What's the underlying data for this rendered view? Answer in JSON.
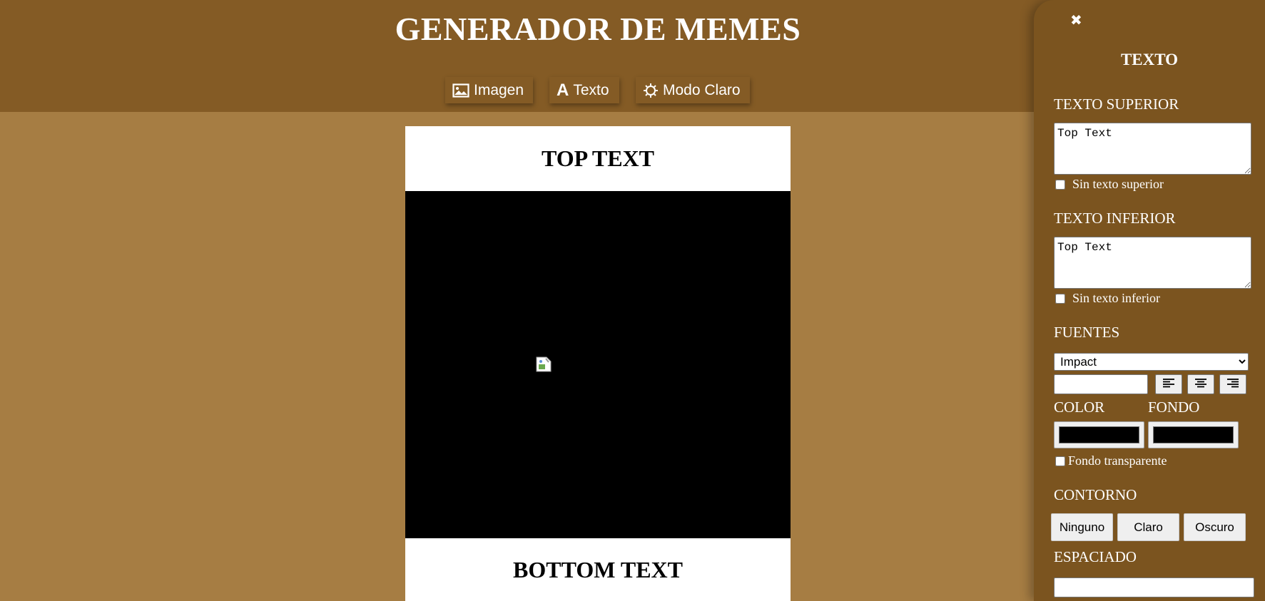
{
  "header": {
    "title": "GENERADOR DE MEMES",
    "nav": [
      {
        "label": "Imagen",
        "icon": "image-icon"
      },
      {
        "label": "Texto",
        "icon": "text-icon"
      },
      {
        "label": "Modo Claro",
        "icon": "sun-icon"
      }
    ]
  },
  "meme": {
    "top_text": "TOP TEXT",
    "bottom_text": "BOTTOM TEXT",
    "image_background": "#000000"
  },
  "panel": {
    "title": "TEXTO",
    "close_icon": "close-icon",
    "top_text": {
      "label": "TEXTO SUPERIOR",
      "value": "Top Text",
      "checkbox_label": "Sin texto superior"
    },
    "bottom_text": {
      "label": "TEXTO INFERIOR",
      "value": "Top Text",
      "checkbox_label": "Sin texto inferior"
    },
    "fonts": {
      "label": "FUENTES",
      "selected": "Impact"
    },
    "color": {
      "label": "COLOR",
      "value": "#000000"
    },
    "background": {
      "label": "FONDO",
      "value": "#000000",
      "transparent_label": "Fondo transparente"
    },
    "outline": {
      "label": "CONTORNO",
      "options": [
        "Ninguno",
        "Claro",
        "Oscuro"
      ]
    },
    "spacing": {
      "label": "ESPACIADO"
    }
  },
  "colors": {
    "page_bg": "#a67d43",
    "header_bg": "#845b25",
    "panel_bg": "#7b541f"
  }
}
